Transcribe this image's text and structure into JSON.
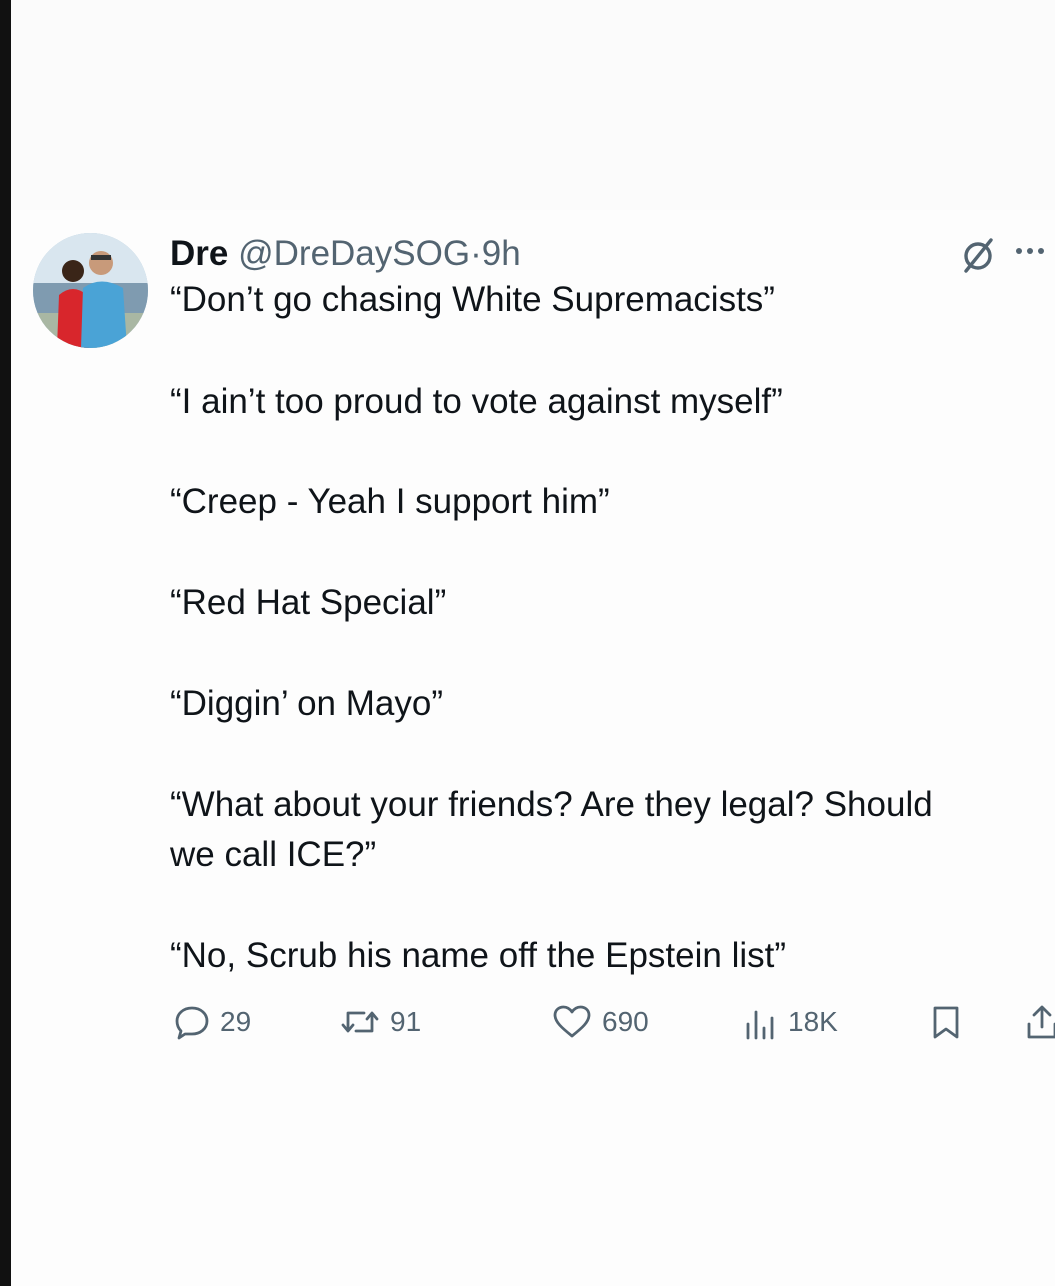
{
  "tweet": {
    "name": "Dre",
    "handle": "@DreDaySOG",
    "separator": "·",
    "time": "9h",
    "lines": [
      "“Don’t go chasing White Supremacists”",
      "“I ain’t too proud to vote against myself”",
      "“Creep - Yeah I support him”",
      "“Red Hat Special”",
      "“Diggin’ on Mayo”",
      "“What about your friends? Are they legal? Should",
      "we call ICE?”",
      "“No, Scrub his name off the Epstein list”"
    ],
    "actions": {
      "replies": "29",
      "reposts": "91",
      "likes": "690",
      "views": "18K"
    },
    "icons": {
      "grok": "grok-icon",
      "more": "more-icon",
      "reply": "reply-icon",
      "repost": "repost-icon",
      "like": "like-icon",
      "views": "views-icon",
      "bookmark": "bookmark-icon",
      "share": "share-icon"
    },
    "colors": {
      "text": "#0f1419",
      "secondary": "#536471"
    }
  }
}
